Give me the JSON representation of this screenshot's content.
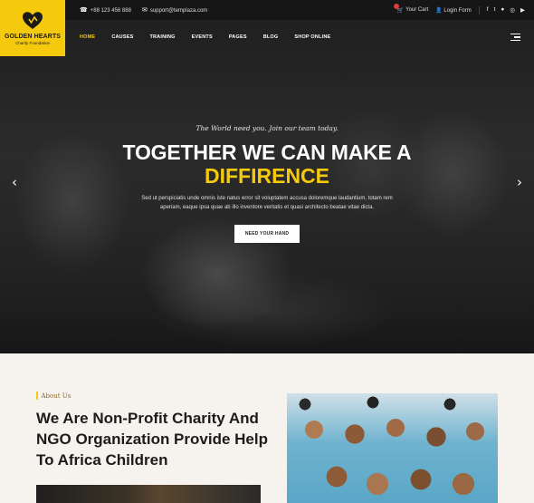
{
  "brand": {
    "name": "GOLDEN HEARTS",
    "tagline": "Charity Foundation",
    "accent": "#f5c90c"
  },
  "topbar": {
    "phone": "+88 123 456 888",
    "email": "support@templaza.com",
    "cart": "Your Cart",
    "login": "Login Form",
    "social": [
      "facebook-icon",
      "twitter-icon",
      "github-icon",
      "dribbble-icon",
      "youtube-icon"
    ]
  },
  "nav": {
    "items": [
      "HOME",
      "CAUSES",
      "TRAINING",
      "EVENTS",
      "PAGES",
      "BLOG",
      "SHOP ONLINE"
    ],
    "active": "HOME"
  },
  "hero": {
    "tagline": "The World need you. Join our team today.",
    "headline_1": "TOGETHER WE CAN MAKE A",
    "headline_2": "DIFFIRENCE",
    "description": "Sed ut perspiciatis unde omnis iste natus error sit voluptatem accusa doloremque laudantium, totam rem aperiam, eaque ipsa quae ab illo inventore veritatis et quasi architecto beatae vitae dicta.",
    "cta": "NEED YOUR HAND"
  },
  "about": {
    "label": "About Us",
    "title": "We Are Non-Profit Charity And NGO Organization Provide Help To Africa Children"
  }
}
